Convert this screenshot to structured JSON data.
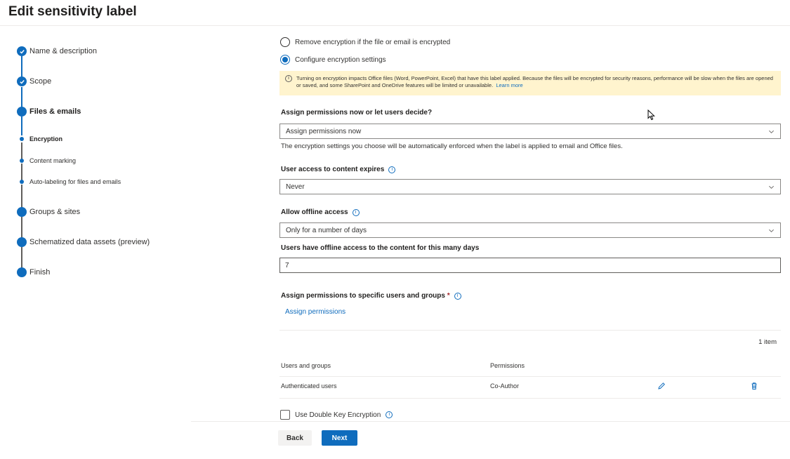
{
  "page": {
    "title": "Edit sensitivity label"
  },
  "wizard": {
    "steps": [
      {
        "label": "Name & description",
        "state": "completed"
      },
      {
        "label": "Scope",
        "state": "completed"
      },
      {
        "label": "Files & emails",
        "state": "current"
      },
      {
        "label": "Encryption",
        "state": "current-sub"
      },
      {
        "label": "Content marking",
        "state": "sub"
      },
      {
        "label": "Auto-labeling for files and emails",
        "state": "sub"
      },
      {
        "label": "Groups & sites",
        "state": "pending"
      },
      {
        "label": "Schematized data assets (preview)",
        "state": "pending"
      },
      {
        "label": "Finish",
        "state": "pending"
      }
    ]
  },
  "encryption": {
    "remove_option": "Remove encryption if the file or email is encrypted",
    "configure_option": "Configure encryption settings",
    "selected": "configure",
    "warning_text": "Turning on encryption impacts Office files (Word, PowerPoint, Excel) that have this label applied. Because the files will be encrypted for security reasons, performance will be slow when the files are opened or saved, and some SharePoint and OneDrive features will be limited or unavailable.",
    "warning_link": "Learn more"
  },
  "assign_mode": {
    "label": "Assign permissions now or let users decide?",
    "value": "Assign permissions now",
    "helper": "The encryption settings you choose will be automatically enforced when the label is applied to email and Office files."
  },
  "expiry": {
    "label": "User access to content expires",
    "value": "Never"
  },
  "offline": {
    "label": "Allow offline access",
    "value": "Only for a number of days",
    "days_label": "Users have offline access to the content for this many days",
    "days_value": "7"
  },
  "permissions": {
    "label": "Assign permissions to specific users and groups",
    "required_mark": "*",
    "assign_link": "Assign permissions",
    "count": "1 item",
    "columns": [
      "Users and groups",
      "Permissions"
    ],
    "rows": [
      {
        "user": "Authenticated users",
        "permission": "Co-Author"
      }
    ]
  },
  "dke": {
    "label": "Use Double Key Encryption",
    "checked": false
  },
  "footer": {
    "back": "Back",
    "next": "Next"
  },
  "colors": {
    "accent": "#0f6cbd",
    "warning_bg": "#fff4ce",
    "required": "#a4262c"
  },
  "icons": [
    "check-icon",
    "info-icon",
    "chevron-down-icon",
    "edit-icon",
    "delete-icon",
    "cursor-icon"
  ]
}
